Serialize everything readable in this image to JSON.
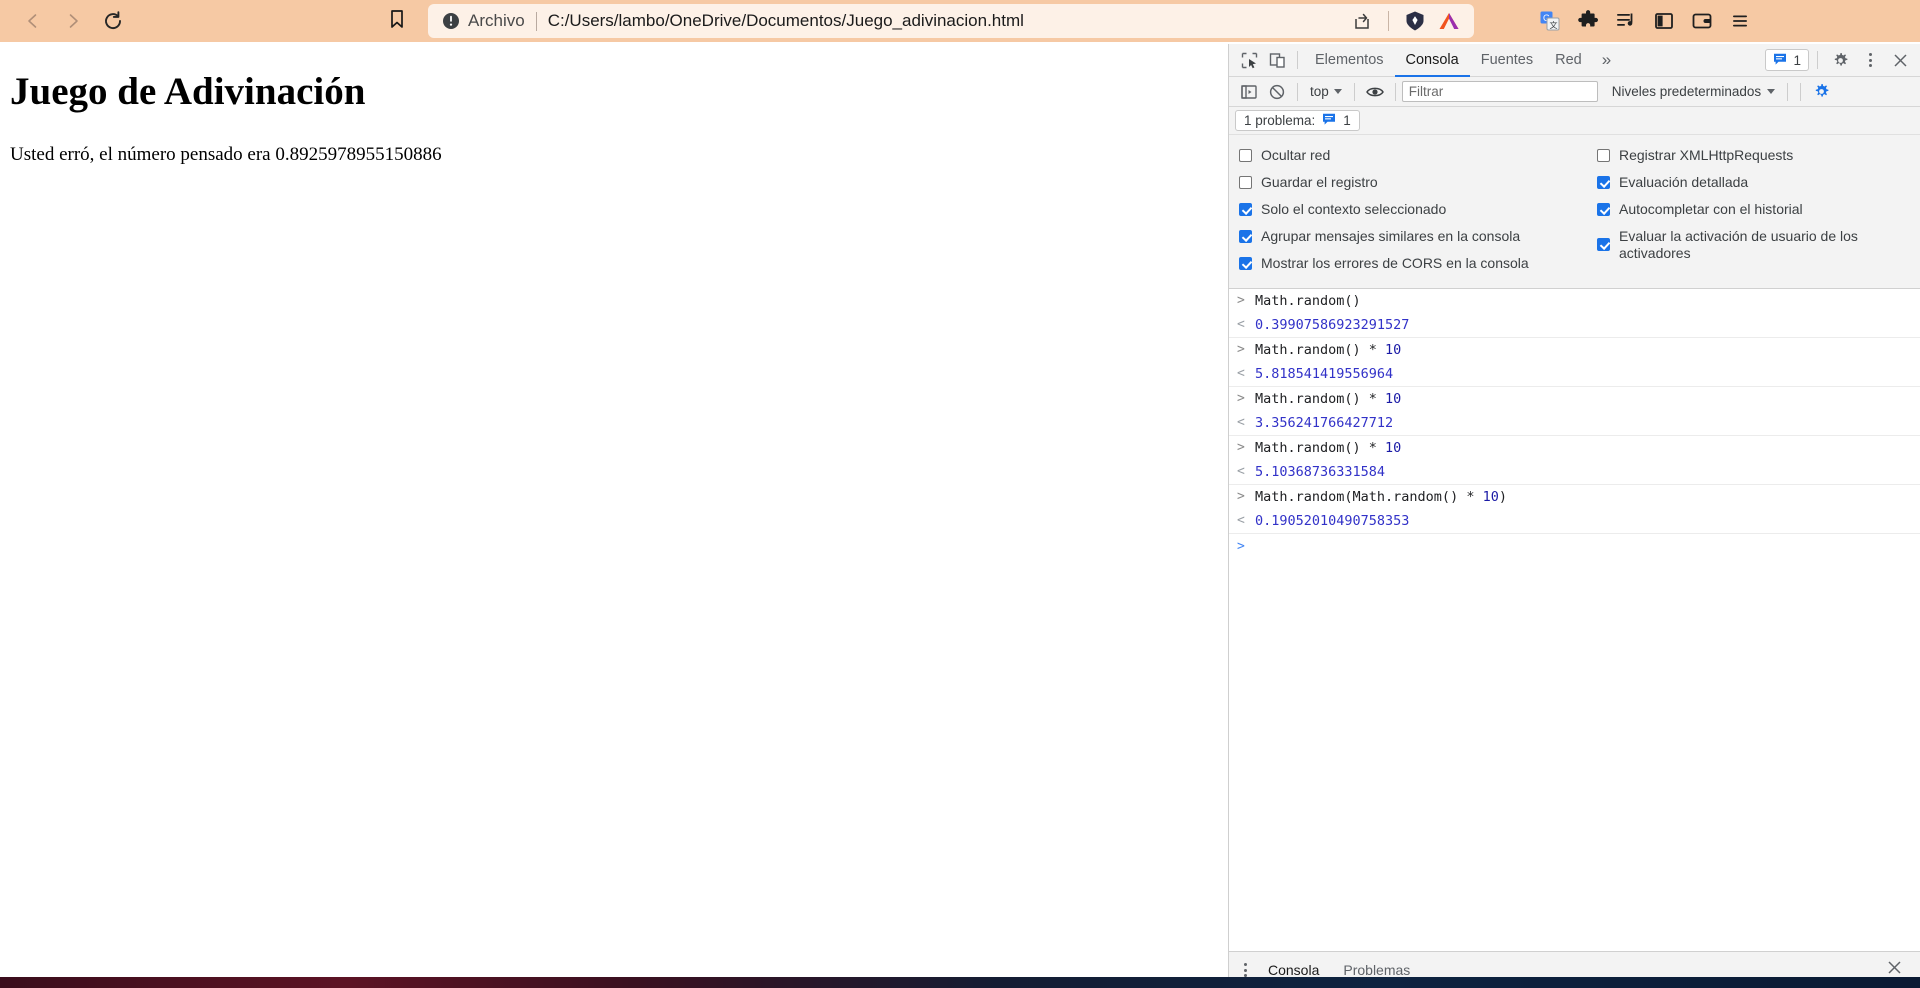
{
  "browser": {
    "nav": {
      "back_label": "Atrás",
      "forward_label": "Adelante",
      "reload_label": "Volver a cargar"
    },
    "bookmark_label": "Marcador",
    "omnibox": {
      "scheme_label": "Archivo",
      "url": "C:/Users/lambo/OneDrive/Documentos/Juego_adivinacion.html",
      "info_icon": "info-circle-icon",
      "share_icon": "share-icon",
      "brave_shields_icon": "brave-lion-icon",
      "brave_rewards_icon": "brave-triangle-icon"
    },
    "toolbar_icons": [
      {
        "name": "translate-icon",
        "label": "Traducir"
      },
      {
        "name": "extensions-puzzle-icon",
        "label": "Extensiones"
      },
      {
        "name": "playlist-icon",
        "label": "Lista de reproducción"
      },
      {
        "name": "sidebar-icon",
        "label": "Barra lateral"
      },
      {
        "name": "wallet-icon",
        "label": "Billetera"
      },
      {
        "name": "browser-menu-icon",
        "label": "Personalizar y controlar Brave"
      }
    ]
  },
  "page": {
    "title": "Juego de Adivinación",
    "paragraph": "Usted erró, el número pensado era 0.8925978955150886"
  },
  "devtools": {
    "topbar": {
      "inspect_icon": "inspect-element-icon",
      "device_icon": "device-toolbar-icon",
      "tabs": [
        {
          "label": "Elementos",
          "active": false
        },
        {
          "label": "Consola",
          "active": true
        },
        {
          "label": "Fuentes",
          "active": false
        },
        {
          "label": "Red",
          "active": false
        }
      ],
      "more_tabs_label": "»",
      "issues_count": "1",
      "issues_icon": "issue-message-icon",
      "settings_icon": "gear-icon",
      "menu_icon": "kebab-menu-icon",
      "close_icon": "close-icon"
    },
    "console_toolbar": {
      "sidebar_icon": "console-sidebar-icon",
      "clear_icon": "clear-console-icon",
      "context_value": "top",
      "live_expression_icon": "eye-icon",
      "filter_placeholder": "Filtrar",
      "filter_value": "",
      "levels_value": "Niveles predeterminados",
      "settings_icon": "console-settings-gear-icon"
    },
    "problem_bar": {
      "label": "1 problema:",
      "icon": "issue-message-icon",
      "count": "1"
    },
    "settings": {
      "left_column": [
        {
          "label": "Ocultar red",
          "checked": false
        },
        {
          "label": "Guardar el registro",
          "checked": false
        },
        {
          "label": "Solo el contexto seleccionado",
          "checked": true
        },
        {
          "label": "Agrupar mensajes similares en la consola",
          "checked": true
        },
        {
          "label": "Mostrar los errores de CORS en la consola",
          "checked": true
        }
      ],
      "right_column": [
        {
          "label": "Registrar XMLHttpRequests",
          "checked": false
        },
        {
          "label": "Evaluación detallada",
          "checked": true
        },
        {
          "label": "Autocompletar con el historial",
          "checked": true
        },
        {
          "label": "Evaluar la activación de usuario de los activadores",
          "checked": true
        }
      ]
    },
    "console_entries": [
      {
        "input": "Math.random()",
        "input_num": "",
        "output": "0.39907586923291527"
      },
      {
        "input": "Math.random() * ",
        "input_num": "10",
        "output": "5.818541419556964"
      },
      {
        "input": "Math.random() * ",
        "input_num": "10",
        "output": "3.356241766427712"
      },
      {
        "input": "Math.random() * ",
        "input_num": "10",
        "output": "5.10368736331584"
      },
      {
        "input": "Math.random(Math.random() * ",
        "input_num": "10",
        "input_tail": ")",
        "output": "0.19052010490758353"
      }
    ],
    "prompt_symbol": ">",
    "drawer": {
      "menu_icon": "kebab-menu-icon",
      "tabs": [
        {
          "label": "Consola",
          "active": true
        },
        {
          "label": "Problemas",
          "active": false
        }
      ],
      "close_icon": "close-icon"
    }
  },
  "colors": {
    "chrome_bg": "#f6c9a4",
    "omnibox_bg": "#fdf1e7",
    "accent_blue": "#1a73e8",
    "console_value": "#3232c8",
    "number_literal": "#1a1aa6"
  }
}
